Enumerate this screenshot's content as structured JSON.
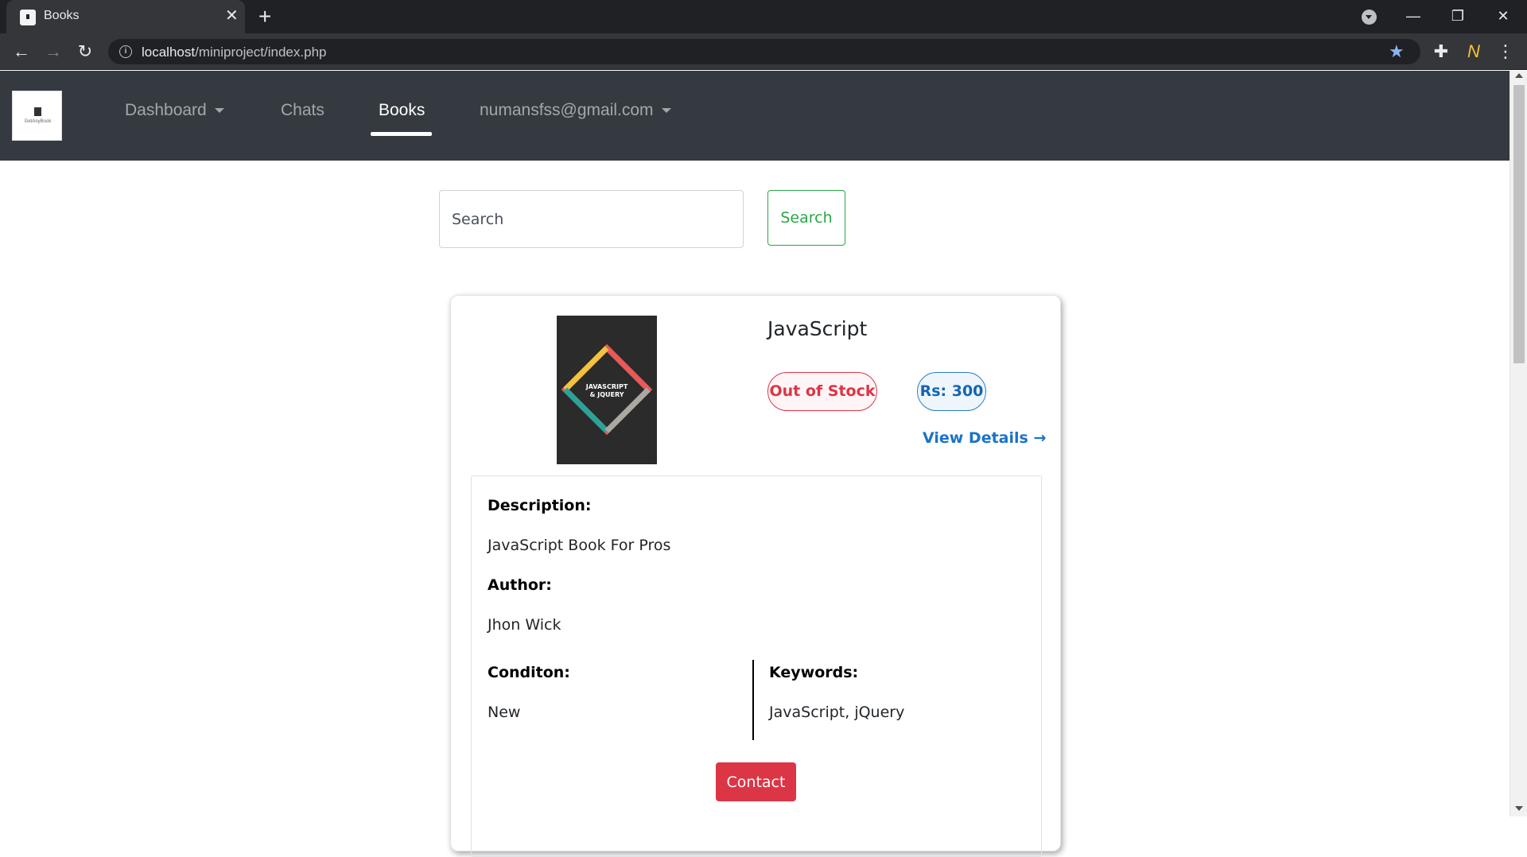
{
  "browser": {
    "tab_title": "Books",
    "close_glyph": "✕",
    "newtab_glyph": "+",
    "url_host": "localhost",
    "url_path": "/miniproject/index.php",
    "back_glyph": "←",
    "forward_glyph": "→",
    "reload_glyph": "↻",
    "star_glyph": "★",
    "puzzle_glyph": "✚",
    "ext_n_glyph": "N",
    "menu_glyph": "⋮",
    "minimize_glyph": "—",
    "restore_glyph": "❐",
    "window_close_glyph": "✕"
  },
  "navbar": {
    "logo_text": "GetAnyBook",
    "links": {
      "dashboard": "Dashboard",
      "chats": "Chats",
      "books": "Books",
      "account": "numansfss@gmail.com"
    },
    "active": "Books"
  },
  "search": {
    "placeholder": "Search",
    "button_label": "Search"
  },
  "book": {
    "title": "JavaScript",
    "cover_text_1": "JAVASCRIPT",
    "cover_text_2": "& JQUERY",
    "stock_badge": "Out of Stock",
    "price_badge": "Rs: 300",
    "view_details": "View Details →",
    "description_label": "Description:",
    "description": "JavaScript Book For Pros",
    "author_label": "Author:",
    "author": "Jhon Wick",
    "condition_label": "Conditon:",
    "condition": "New",
    "keywords_label": "Keywords:",
    "keywords": "JavaScript, jQuery",
    "contact_label": "Contact"
  },
  "colors": {
    "navbar_bg": "#343a40",
    "danger": "#dc3545",
    "success": "#28a745",
    "link": "#1a73c8"
  }
}
